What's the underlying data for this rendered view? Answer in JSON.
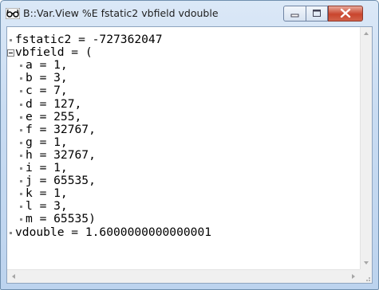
{
  "window": {
    "title": "B::Var.View %E fstatic2 vbfield vdouble",
    "icon": "glasses-icon"
  },
  "controls": [
    "minimize-icon",
    "maximize-icon",
    "close-icon"
  ],
  "lines": [
    {
      "text": "fstatic2 = -727362047",
      "marker": "bullet",
      "indent": 0
    },
    {
      "text": "vbfield = (",
      "marker": "expander",
      "indent": 0
    },
    {
      "text": "a = 1,",
      "marker": "bullet",
      "indent": 1
    },
    {
      "text": "b = 3,",
      "marker": "bullet",
      "indent": 1
    },
    {
      "text": "c = 7,",
      "marker": "bullet",
      "indent": 1
    },
    {
      "text": "d = 127,",
      "marker": "bullet",
      "indent": 1
    },
    {
      "text": "e = 255,",
      "marker": "bullet",
      "indent": 1
    },
    {
      "text": "f = 32767,",
      "marker": "bullet",
      "indent": 1
    },
    {
      "text": "g = 1,",
      "marker": "bullet",
      "indent": 1
    },
    {
      "text": "h = 32767,",
      "marker": "bullet",
      "indent": 1
    },
    {
      "text": "i = 1,",
      "marker": "bullet",
      "indent": 1
    },
    {
      "text": "j = 65535,",
      "marker": "bullet",
      "indent": 1
    },
    {
      "text": "k = 1,",
      "marker": "bullet",
      "indent": 1
    },
    {
      "text": "l = 3,",
      "marker": "bullet",
      "indent": 1
    },
    {
      "text": "m = 65535)",
      "marker": "bullet",
      "indent": 1
    },
    {
      "text": "vdouble = 1.6000000000000001",
      "marker": "bullet",
      "indent": 0
    }
  ]
}
